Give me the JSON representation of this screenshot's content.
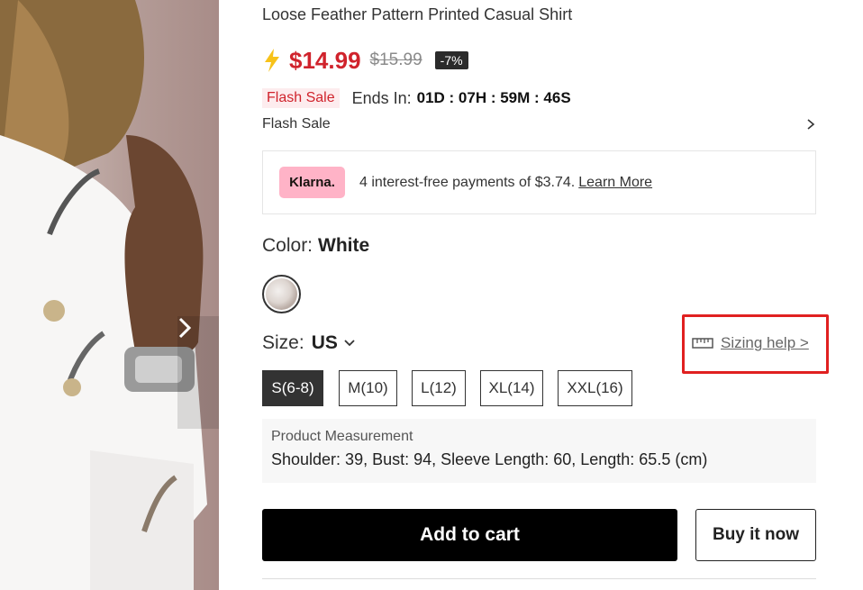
{
  "product": {
    "title": "Loose Feather Pattern Printed Casual Shirt",
    "price": "$14.99",
    "old_price": "$15.99",
    "discount": "-7%"
  },
  "flash": {
    "tag": "Flash Sale",
    "ends_label": "Ends In:",
    "countdown": "01D : 07H : 59M : 46S",
    "subtitle": "Flash Sale"
  },
  "klarna": {
    "badge": "Klarna.",
    "text": "4 interest-free payments of $3.74.",
    "link": "Learn More"
  },
  "color": {
    "label": "Color:",
    "value": "White"
  },
  "size": {
    "label": "Size:",
    "unit": "US",
    "help": "Sizing help >",
    "options": [
      "S(6-8)",
      "M(10)",
      "L(12)",
      "XL(14)",
      "XXL(16)"
    ],
    "selected": "S(6-8)"
  },
  "measurement": {
    "title": "Product Measurement",
    "values": "Shoulder: 39, Bust: 94, Sleeve Length: 60, Length: 65.5 (cm)"
  },
  "actions": {
    "add_to_cart": "Add to cart",
    "buy_now": "Buy it now"
  },
  "colors": {
    "accent_red": "#d0232c",
    "highlight_box": "#e02020",
    "klarna_pink": "#ffb3c7",
    "primary_button": "#000000"
  },
  "icons": {
    "price_flash": "lightning-bolt-icon",
    "flash_expand": "chevron-right-icon",
    "size_unit": "chevron-down-icon",
    "sizing_help": "ruler-icon",
    "image_next": "chevron-right-icon"
  }
}
